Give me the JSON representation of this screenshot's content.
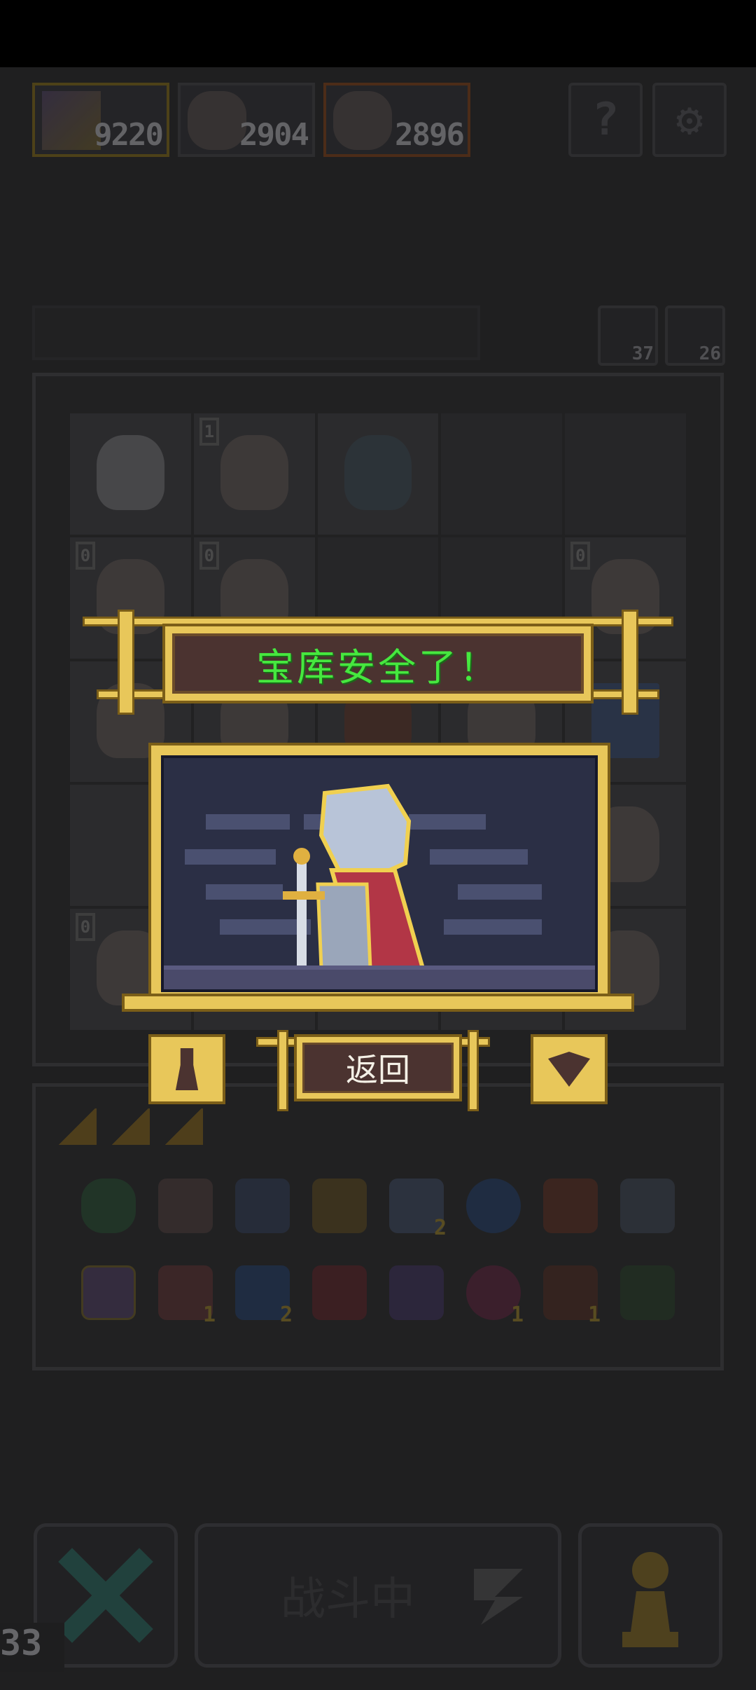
{
  "resources": [
    {
      "name": "wand",
      "value": "9220"
    },
    {
      "name": "hero-1",
      "value": "2904"
    },
    {
      "name": "hero-2",
      "value": "2896"
    }
  ],
  "top_buttons": {
    "help": "?",
    "settings_icon": "gear-icon"
  },
  "side_counters": [
    {
      "icon": "return-icon",
      "value": "37"
    },
    {
      "icon": "key-icon",
      "value": "26"
    }
  ],
  "board": {
    "level_badges": [
      "1",
      "0",
      "0",
      "0",
      "0"
    ]
  },
  "inventory": {
    "row1_counts": [
      "",
      "",
      "",
      "",
      "2",
      "",
      "",
      ""
    ],
    "row2_counts": [
      "",
      "1",
      "2",
      "",
      "",
      "1",
      "1",
      ""
    ]
  },
  "popup": {
    "title": "宝库安全了！",
    "back_label": "返回"
  },
  "bottom": {
    "fight_label": "战斗中",
    "corner_number": "33"
  },
  "colors": {
    "gold": "#e8c75a",
    "banner_bg": "#4b3330",
    "banner_text": "#46e83f",
    "scene_bg": "#2b2f45"
  }
}
